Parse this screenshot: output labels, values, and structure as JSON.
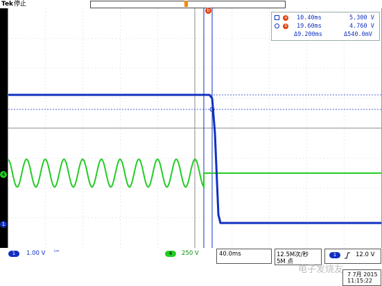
{
  "header": {
    "brand": "Tek",
    "status": "停止"
  },
  "cursors": {
    "a": {
      "badge": "a",
      "time": "10.40ms",
      "voltage": "5.300 V"
    },
    "b": {
      "badge": "b",
      "time": "19.60ms",
      "voltage": "4.760 V"
    },
    "delta": {
      "time": "Δ9.200ms",
      "voltage": "Δ540.0mV"
    }
  },
  "markers": {
    "ch4": "4",
    "ch1": "1",
    "cursor_b": "b"
  },
  "channels": [
    {
      "id": "1",
      "scale": "1.00 V",
      "coupling": "ᵇᵂ",
      "color": "#1030c0"
    },
    {
      "id": "4",
      "scale": "250 V",
      "color": "#22cc22"
    }
  ],
  "timebase": {
    "scale": "40.0ms"
  },
  "acquisition": {
    "rate": "12.5M次/秒",
    "record": "5M 点"
  },
  "trigger": {
    "source": "1",
    "slope_icon": "rising-edge-icon",
    "level": "12.0 V"
  },
  "datetime": {
    "date": "7 7月 2015",
    "time": "11:15:22"
  },
  "watermark": "电子发烧友"
}
